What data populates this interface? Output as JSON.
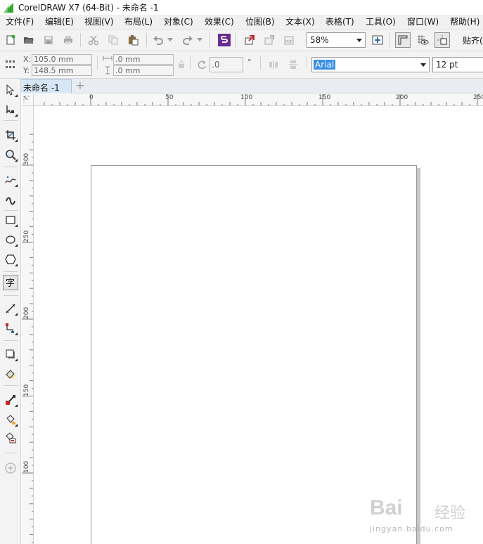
{
  "window": {
    "title": "CorelDRAW X7 (64-Bit) - 未命名 -1"
  },
  "menu": {
    "items": [
      {
        "label": "文件(F)"
      },
      {
        "label": "编辑(E)"
      },
      {
        "label": "视图(V)"
      },
      {
        "label": "布局(L)"
      },
      {
        "label": "对象(C)"
      },
      {
        "label": "效果(C)"
      },
      {
        "label": "位图(B)"
      },
      {
        "label": "文本(X)"
      },
      {
        "label": "表格(T)"
      },
      {
        "label": "工具(O)"
      },
      {
        "label": "窗口(W)"
      },
      {
        "label": "帮助(H)"
      }
    ]
  },
  "toolbar": {
    "zoom_value": "58%",
    "snap_label": "贴齐("
  },
  "property_bar": {
    "x_label": "X:",
    "x_value": "105.0 mm",
    "y_label": "Y:",
    "y_value": "148.5 mm",
    "width_value": ".0 mm",
    "height_value": ".0 mm",
    "angle_value": ".0",
    "degree_symbol": "°",
    "font_name": "Arial",
    "font_size": "12 pt"
  },
  "tabs": {
    "document_tab": "未命名 -1",
    "add_tab": "+"
  },
  "ruler": {
    "horizontal_labels": [
      "0",
      "50",
      "100",
      "150",
      "200",
      "250"
    ],
    "vertical_labels": [
      "300",
      "250",
      "200",
      "150",
      "100"
    ]
  },
  "watermark": {
    "brand": "Bai",
    "chinese": "经验",
    "url": "jingyan.baidu.com"
  },
  "colors": {
    "menubar_bg": "#f0f0f0",
    "toolbar_bg": "#f3f3f3",
    "tab_active_bg": "#d6e6f5",
    "selection_blue": "#3a8ee6",
    "logo_green": "#3aa635"
  }
}
